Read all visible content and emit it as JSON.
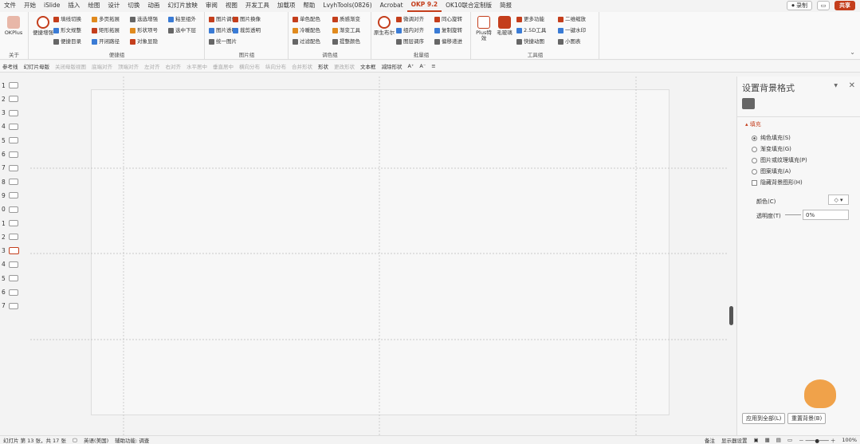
{
  "menu": [
    "文件",
    "开始",
    "iSlide",
    "插入",
    "绘图",
    "设计",
    "切换",
    "动画",
    "幻灯片放映",
    "审阅",
    "视图",
    "开发工具",
    "加载项",
    "帮助",
    "LvyhTools(0826)",
    "Acrobat",
    "OKP 9.2",
    "OK10联合定制版",
    "简报"
  ],
  "active_menu": "OKP 9.2",
  "topright": {
    "record": "⏺ 录制",
    "share": "共享"
  },
  "ribbon": {
    "okplus_label": "OKPlus",
    "about_label": "关于",
    "g1_big": "便捷增强",
    "g1_items": [
      "填线切换",
      "形文规整",
      "便捷目录",
      "多页拓展",
      "矩形拓展",
      "开闭路径",
      "选选增强",
      "形状项号",
      "对象显隐",
      "粘至组外",
      "选中下层"
    ],
    "g1_label": "便捷组",
    "g2_items": [
      "图片调色",
      "图片透明",
      "统一图片",
      "图片换像",
      "裁剪透明"
    ],
    "g2_label": "图片组",
    "g3_items": [
      "单色配色",
      "冷暖配色",
      "过滤配色",
      "质感渐变",
      "渐变工具",
      "提整颜色"
    ],
    "g3_label": "调色组",
    "g4_big": "原生布尔",
    "g4_items": [
      "微调对齐",
      "组内对齐",
      "图层调序",
      "同心旋转",
      "复制旋转",
      "偏移递进"
    ],
    "g4_label": "批量组",
    "g5_big1": "Plus特效",
    "g5_big2": "毛玻璃",
    "g5_items": [
      "更多功能",
      "2.5D工具",
      "快捷动图",
      "二维缩放",
      "一键水印",
      "小图表"
    ],
    "g5_label": "工具组"
  },
  "toolbar2": [
    {
      "t": "参考线",
      "dis": false
    },
    {
      "t": "幻灯片母版",
      "dis": false
    },
    {
      "t": "关闭母版视图",
      "dis": true
    },
    {
      "t": "底端对齐",
      "dis": true
    },
    {
      "t": "顶端对齐",
      "dis": true
    },
    {
      "t": "左对齐",
      "dis": true
    },
    {
      "t": "右对齐",
      "dis": true
    },
    {
      "t": "水平居中",
      "dis": true
    },
    {
      "t": "垂直居中",
      "dis": true
    },
    {
      "t": "横向分布",
      "dis": true
    },
    {
      "t": "纵向分布",
      "dis": true
    },
    {
      "t": "合并形状",
      "dis": true
    },
    {
      "t": "形状",
      "dis": false
    },
    {
      "t": "更改形状",
      "dis": true
    },
    {
      "t": "文本框",
      "dis": false
    },
    {
      "t": "减除形状",
      "dis": false
    },
    {
      "t": "A⁺",
      "dis": false
    },
    {
      "t": "A⁻",
      "dis": false
    },
    {
      "t": "≡",
      "dis": false
    }
  ],
  "slides": [
    "1",
    "2",
    "3",
    "4",
    "5",
    "6",
    "7",
    "8",
    "9",
    "0",
    "1",
    "2",
    "3",
    "4",
    "5",
    "6",
    "7"
  ],
  "selected_slide_index": 12,
  "pane": {
    "title": "设置背景格式",
    "fill_header": "填充",
    "options": [
      "纯色填充(S)",
      "渐变填充(G)",
      "图片或纹理填充(P)",
      "图案填充(A)"
    ],
    "selected_option": 0,
    "hide_bg": "隐藏背景图形(H)",
    "color_label": "颜色(C)",
    "transparency_label": "透明度(T)",
    "transparency_value": "0%",
    "apply_all": "应用到全部(L)",
    "reset": "重置背景(B)"
  },
  "status": {
    "slide_info": "幻灯片 第 13 张，共 17 张",
    "lang": "英语(美国)",
    "access": "辅助功能: 调查",
    "notes": "备注",
    "display": "显示器设置",
    "zoom": "100%"
  }
}
